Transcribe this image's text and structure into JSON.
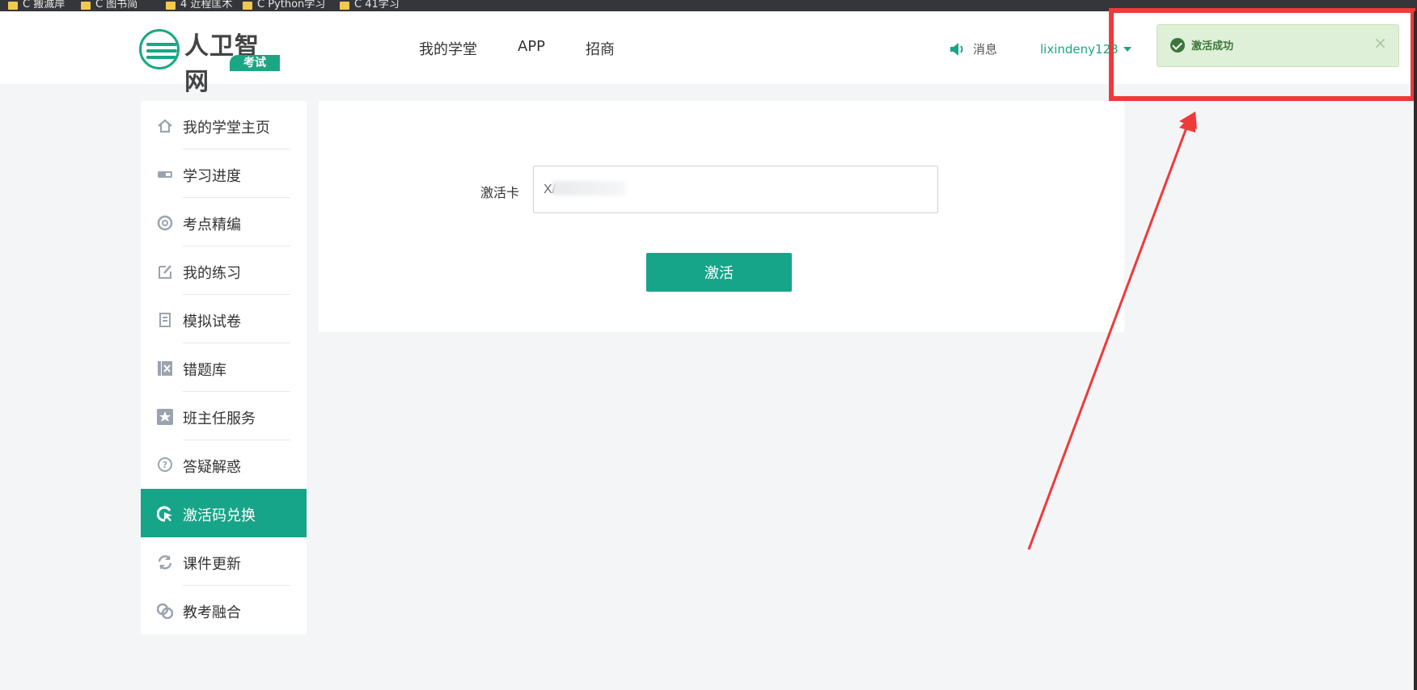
{
  "bookmarks": [
    "C 搬滅岸",
    "C 图书简",
    "4 近程匡木",
    "C Python学习",
    "C 41学习"
  ],
  "header": {
    "logo_brand": "人卫智网",
    "logo_tag": "考试",
    "nav": [
      "我的学堂",
      "APP",
      "招商"
    ],
    "message_label": "消息",
    "username": "lixindeny123"
  },
  "toast": {
    "text": "激活成功",
    "close": "×",
    "accent": "#3c763d",
    "background": "#dff0d8"
  },
  "sidebar": {
    "items": [
      {
        "label": "我的学堂主页",
        "icon": "home-icon"
      },
      {
        "label": "学习进度",
        "icon": "progress-icon"
      },
      {
        "label": "考点精编",
        "icon": "lifebuoy-icon"
      },
      {
        "label": "我的练习",
        "icon": "edit-icon"
      },
      {
        "label": "模拟试卷",
        "icon": "document-icon"
      },
      {
        "label": "错题库",
        "icon": "wrong-icon"
      },
      {
        "label": "班主任服务",
        "icon": "star-icon"
      },
      {
        "label": "答疑解惑",
        "icon": "question-icon"
      },
      {
        "label": "激活码兑换",
        "icon": "cursor-click-icon",
        "active": true
      },
      {
        "label": "课件更新",
        "icon": "refresh-icon"
      },
      {
        "label": "教考融合",
        "icon": "link-circles-icon"
      }
    ]
  },
  "form": {
    "label": "激活卡",
    "value": "X/",
    "button": "激活"
  },
  "colors": {
    "brand": "#17a589",
    "highlight": "#ef3a3a"
  }
}
